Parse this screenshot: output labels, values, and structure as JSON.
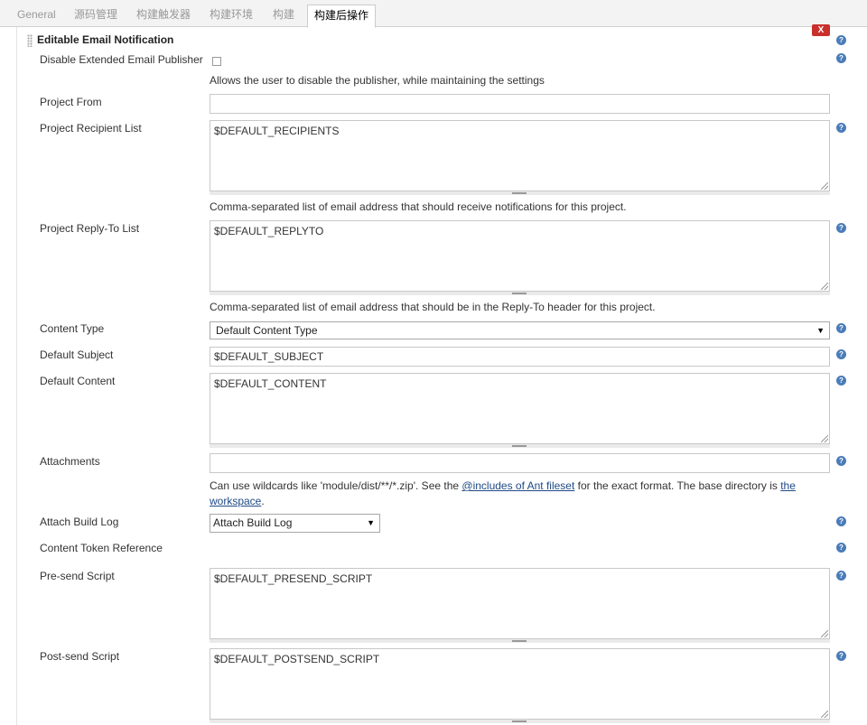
{
  "tabs": [
    {
      "label": "General"
    },
    {
      "label": "源码管理"
    },
    {
      "label": "构建触发器"
    },
    {
      "label": "构建环境"
    },
    {
      "label": "构建"
    },
    {
      "label": "构建后操作"
    }
  ],
  "section": {
    "title": "Editable Email Notification",
    "delete_label": "X"
  },
  "fields": {
    "disable_publisher": {
      "label": "Disable Extended Email Publisher",
      "checked": false,
      "description": "Allows the user to disable the publisher, while maintaining the settings"
    },
    "project_from": {
      "label": "Project From",
      "value": ""
    },
    "recipient_list": {
      "label": "Project Recipient List",
      "value": "$DEFAULT_RECIPIENTS",
      "description": "Comma-separated list of email address that should receive notifications for this project."
    },
    "reply_to": {
      "label": "Project Reply-To List",
      "value": "$DEFAULT_REPLYTO",
      "description": "Comma-separated list of email address that should be in the Reply-To header for this project."
    },
    "content_type": {
      "label": "Content Type",
      "selected": "Default Content Type"
    },
    "default_subject": {
      "label": "Default Subject",
      "value": "$DEFAULT_SUBJECT"
    },
    "default_content": {
      "label": "Default Content",
      "value": "$DEFAULT_CONTENT"
    },
    "attachments": {
      "label": "Attachments",
      "value": "",
      "desc_before": "Can use wildcards like 'module/dist/**/*.zip'. See the ",
      "desc_link1": "@includes of Ant fileset",
      "desc_middle": " for the exact format. The base directory is ",
      "desc_link2a": "the",
      "desc_link2b": "workspace",
      "desc_end": "."
    },
    "attach_build_log": {
      "label": "Attach Build Log",
      "selected": "Attach Build Log"
    },
    "content_token": {
      "label": "Content Token Reference"
    },
    "presend_script": {
      "label": "Pre-send Script",
      "value": "$DEFAULT_PRESEND_SCRIPT"
    },
    "postsend_script": {
      "label": "Post-send Script",
      "value": "$DEFAULT_POSTSEND_SCRIPT"
    }
  },
  "help_glyph": "?",
  "dropdown_glyph": "▼",
  "colors": {
    "help": "#4a7cb8",
    "delete": "#c9302c",
    "link": "#204a87"
  }
}
